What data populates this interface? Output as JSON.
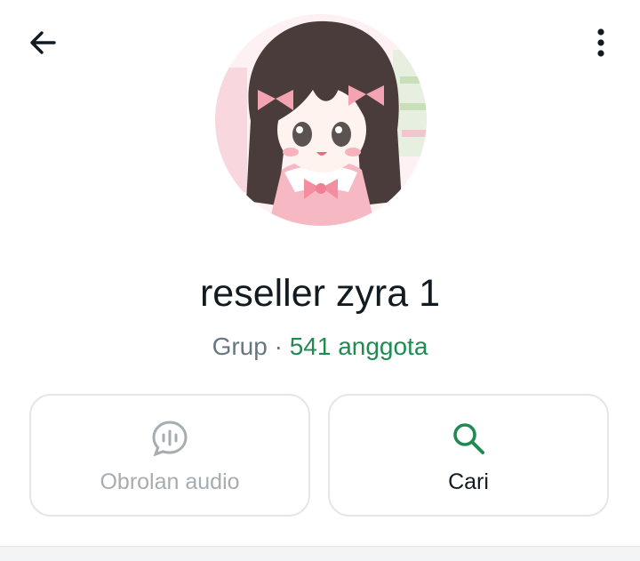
{
  "header": {
    "back_icon": "arrow-left-icon",
    "menu_icon": "more-vertical-icon"
  },
  "group": {
    "name": "reseller zyra 1",
    "type_label": "Grup",
    "separator": "·",
    "members_label": "541 anggota",
    "avatar": "anime-girl-avatar"
  },
  "actions": [
    {
      "label": "Obrolan audio",
      "icon": "audio-chat-icon",
      "enabled": false
    },
    {
      "label": "Cari",
      "icon": "search-icon",
      "enabled": true
    }
  ],
  "colors": {
    "accent": "#1f8a52",
    "primary_text": "#111b21",
    "secondary_text": "#667781",
    "disabled_text": "#a7acb0",
    "card_border": "#e4e6e8"
  }
}
